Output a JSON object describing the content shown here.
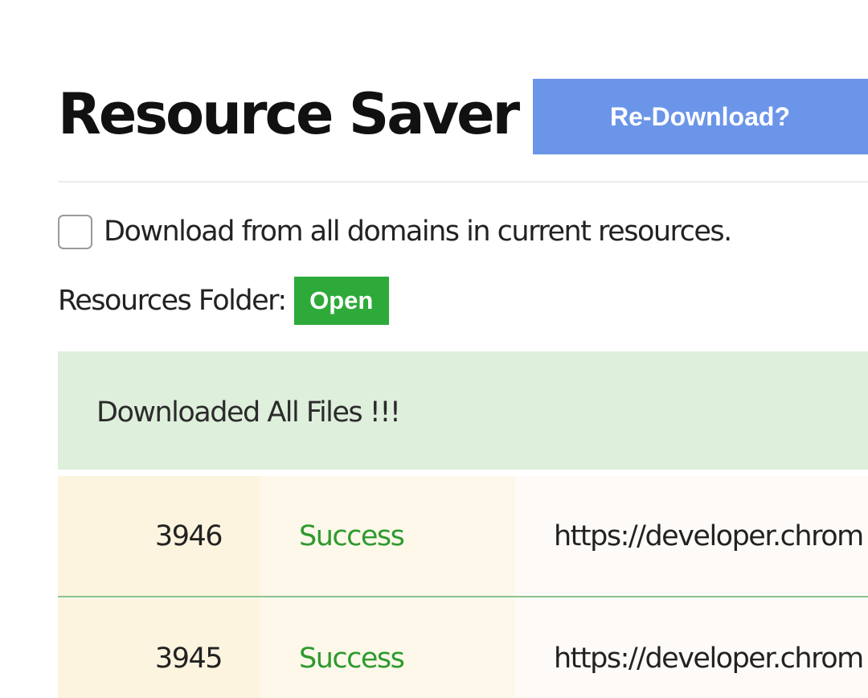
{
  "header": {
    "title": "Resource Saver",
    "redownload_label": "Re-Download?"
  },
  "options": {
    "all_domains_label": "Download from all domains in current resources.",
    "all_domains_checked": false
  },
  "folder": {
    "label": "Resources Folder:",
    "open_label": "Open"
  },
  "status": {
    "message": "Downloaded All Files !!!"
  },
  "results": [
    {
      "id": "3946",
      "status": "Success",
      "url": "https://developer.chrom"
    },
    {
      "id": "3945",
      "status": "Success",
      "url": "https://developer.chrom"
    }
  ],
  "colors": {
    "accent_blue": "#6b95e8",
    "open_green": "#2eaa3a",
    "success_text": "#2e9a2e",
    "banner_bg": "#deefdc"
  }
}
